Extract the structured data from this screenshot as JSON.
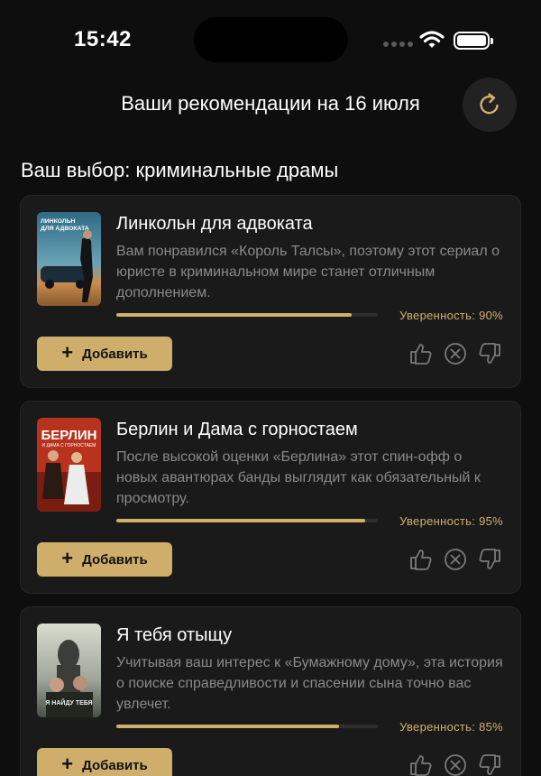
{
  "status_bar": {
    "time": "15:42"
  },
  "header": {
    "title": "Ваши рекомендации на 16 июля",
    "refresh_icon": "refresh-icon"
  },
  "section": {
    "title": "Ваш выбор: криминальные драмы"
  },
  "cards": [
    {
      "title": "Линкольн для адвоката",
      "description": "Вам понравился «Король Талсы», поэтому этот сериал о юристе в криминальном мире станет отличным дополнением.",
      "confidence_label": "Уверенность: 90%",
      "confidence": 0.9,
      "add_label": "Добавить",
      "poster_text": "ЛИНКОЛЬН ДЛЯ АДВОКАТА"
    },
    {
      "title": "Берлин и Дама с горностаем",
      "description": "После высокой оценки «Берлина» этот спин-офф о новых авантюрах банды выглядит как обязательный к просмотру.",
      "confidence_label": "Уверенность: 95%",
      "confidence": 0.95,
      "add_label": "Добавить",
      "poster_text": "БЕРЛИН"
    },
    {
      "title": "Я тебя отыщу",
      "description": "Учитывая ваш интерес к «Бумажному дому», эта история о поиске справедливости и спасении сына точно вас увлечет.",
      "confidence_label": "Уверенность: 85%",
      "confidence": 0.85,
      "add_label": "Добавить",
      "poster_text": "Я НАЙДУ ТЕБЯ"
    }
  ],
  "colors": {
    "accent": "#cfae6b",
    "card_bg": "#1a1a1a",
    "muted_text": "#8a8a8a"
  }
}
